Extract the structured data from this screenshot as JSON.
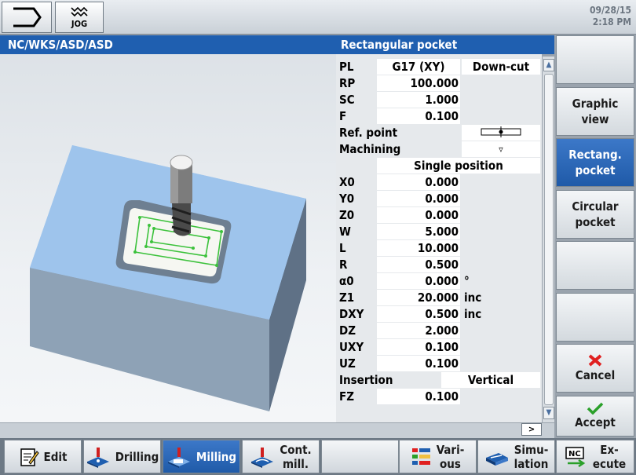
{
  "header": {
    "jog_label": "JOG",
    "date": "09/28/15",
    "time": "2:18 PM"
  },
  "path": "NC/WKS/ASD/ASD",
  "form": {
    "title": "Rectangular pocket",
    "pl": {
      "label": "PL",
      "value": "G17 (XY)",
      "mode": "Down-cut"
    },
    "rows1": [
      {
        "label": "RP",
        "value": "100.000"
      },
      {
        "label": "SC",
        "value": "1.000"
      },
      {
        "label": "F",
        "value": "0.100"
      }
    ],
    "ref_point_label": "Ref. point",
    "machining_label": "Machining",
    "machining_icon": "▿",
    "position_mode": "Single position",
    "rows2": [
      {
        "label": "X0",
        "value": "0.000",
        "unit": ""
      },
      {
        "label": "Y0",
        "value": "0.000",
        "unit": ""
      },
      {
        "label": "Z0",
        "value": "0.000",
        "unit": ""
      },
      {
        "label": "W",
        "value": "5.000",
        "unit": ""
      },
      {
        "label": "L",
        "value": "10.000",
        "unit": ""
      },
      {
        "label": "R",
        "value": "0.500",
        "unit": ""
      },
      {
        "label": "α0",
        "value": "0.000",
        "unit": "°"
      },
      {
        "label": "Z1",
        "value": "20.000",
        "unit": "inc"
      },
      {
        "label": "DXY",
        "value": "0.500",
        "unit": "inc"
      },
      {
        "label": "DZ",
        "value": "2.000",
        "unit": ""
      },
      {
        "label": "UXY",
        "value": "0.100",
        "unit": ""
      },
      {
        "label": "UZ",
        "value": "0.100",
        "unit": ""
      }
    ],
    "insertion_label": "Insertion",
    "insertion_value": "Vertical",
    "fz": {
      "label": "FZ",
      "value": "0.100"
    }
  },
  "next_label": ">",
  "vertical_softkeys": [
    {
      "label1": "",
      "label2": ""
    },
    {
      "label1": "Graphic",
      "label2": "view"
    },
    {
      "label1": "Rectang.",
      "label2": "pocket"
    },
    {
      "label1": "Circular",
      "label2": "pocket"
    },
    {
      "label1": "",
      "label2": ""
    },
    {
      "label1": "",
      "label2": ""
    },
    {
      "label1": "Cancel",
      "label2": ""
    },
    {
      "label1": "Accept",
      "label2": ""
    }
  ],
  "horizontal_softkeys": [
    {
      "label1": "Edit",
      "label2": ""
    },
    {
      "label1": "Drilling",
      "label2": ""
    },
    {
      "label1": "Milling",
      "label2": ""
    },
    {
      "label1": "Cont.",
      "label2": "mill."
    },
    {
      "label1": "",
      "label2": ""
    },
    {
      "label1": "Vari-",
      "label2": "ous"
    },
    {
      "label1": "Simu-",
      "label2": "lation"
    },
    {
      "label1": "Ex-",
      "label2": "ecute"
    }
  ],
  "colors": {
    "accent": "#1f5fb0",
    "cancel": "#e02020",
    "accept": "#2aa02a",
    "toolpath": "#3cc23c"
  }
}
